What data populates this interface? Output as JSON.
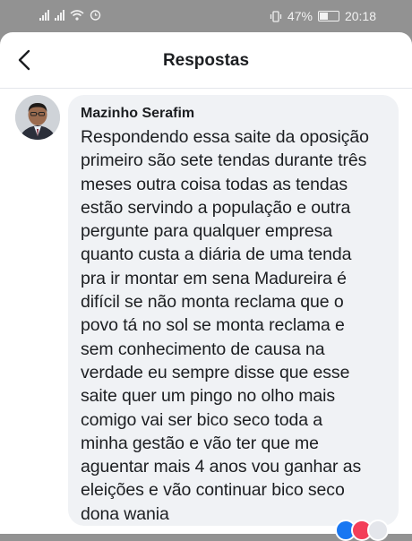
{
  "status": {
    "battery_percent": "47%",
    "time": "20:18"
  },
  "header": {
    "title": "Respostas"
  },
  "comment": {
    "author": "Mazinho Serafim",
    "text": "Respondendo essa saite da oposição\nprimeiro são sete tendas durante três\nmeses outra coisa todas as tendas\nestão servindo a população e outra\npergunte para qualquer empresa\nquanto custa a diária de uma tenda\npra ir montar em sena Madureira é\ndifícil se não  monta reclama que o\npovo tá no sol se monta reclama e\nsem conhecimento de causa na\nverdade eu sempre disse que esse\nsaite quer um pingo no olho mais\ncomigo vai ser bico seco toda a\nminha gestão e vão ter que me\naguentar mais 4 anos vou ganhar as\neleições e vão continuar bico seco\ndona wania"
  },
  "colors": {
    "accent_like": "#1877f2",
    "accent_love": "#f33e58",
    "bubble_bg": "#f0f2f5"
  }
}
